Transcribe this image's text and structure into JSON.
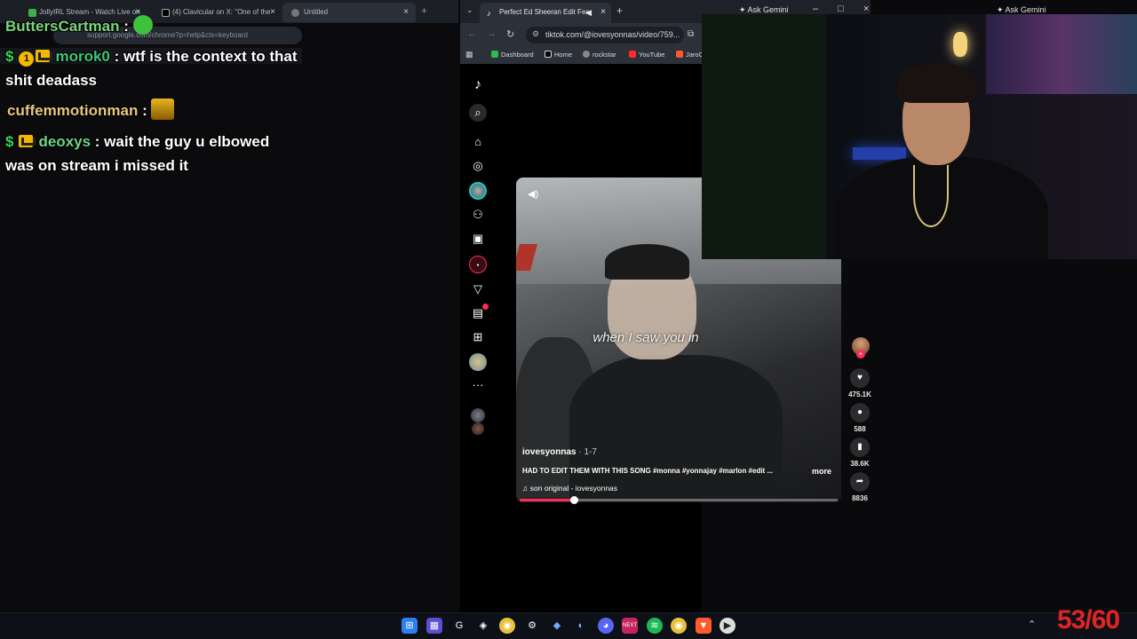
{
  "left_browser": {
    "tabs": [
      {
        "label": "JollyIRL Stream - Watch Live on"
      },
      {
        "label": "(4) Clavicular on X: \"One of the"
      },
      {
        "label": "Untitled"
      }
    ],
    "address_text": "support.google.com/chrome?p=help&ctx=keyboard"
  },
  "chat": {
    "messages": [
      {
        "user": "ButtersCartman",
        "user_color": "#7cd67c",
        "text": "",
        "emote": "green"
      },
      {
        "user": "morok0",
        "user_color": "#3fc77a",
        "text": "wtf is the context to that shit deadass",
        "badges": [
          "coin",
          "crown"
        ]
      },
      {
        "user": "cuffemmotionman",
        "user_color": "#e8c77f",
        "text": "",
        "emote": "gold"
      },
      {
        "user": "deoxys",
        "user_color": "#6fd48a",
        "text": "wait the guy u elbowed was on stream i missed it",
        "badges": [
          "dollar",
          "crown"
        ]
      }
    ],
    "badge_coin_text": "1",
    "badge_dollar_text": "$",
    "separator": " : "
  },
  "tiktok_browser": {
    "tab_title": "Perfect Ed Sheeran Edit Fea",
    "url": "tiktok.com/@iovesyonnas/video/759...",
    "bookmarks": [
      {
        "label": "Dashboard",
        "color": "#35b84a"
      },
      {
        "label": "Home",
        "color": "#ffffff"
      },
      {
        "label": "rockstar",
        "color": "#cccccc"
      },
      {
        "label": "YouTube",
        "color": "#ff2a2a"
      },
      {
        "label": "JaroC",
        "color": "#ff5a2a"
      }
    ]
  },
  "video": {
    "caption": "when I saw you in",
    "author": "iovesyonnas",
    "date": " · 1-7",
    "description": "HAD TO EDIT THEM WITH THIS SONG #monna #yonnajay #marlon #edit ...",
    "more_label": "more",
    "sound": "son original - iovesyonnas",
    "progress_fraction": 0.17,
    "likes": "475.1K",
    "comments": "588",
    "saves": "38.6K",
    "shares": "8836"
  },
  "overlay": {
    "ask_gemini_1": "Ask Gemini",
    "ask_gemini_2": "Ask Gemini",
    "fps_counter": "53/60"
  },
  "colors": {
    "tiktok_accent": "#fe2c55",
    "fps_red": "#e02424"
  }
}
